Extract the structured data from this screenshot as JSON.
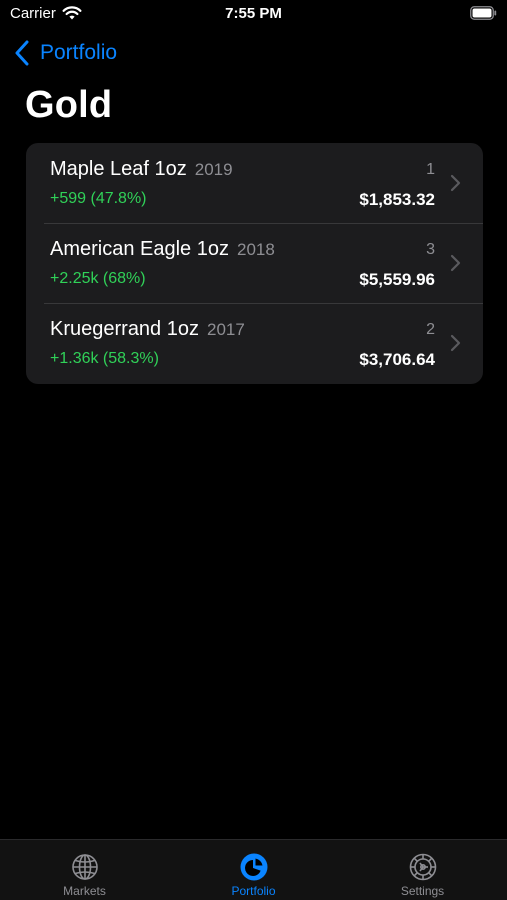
{
  "status_bar": {
    "carrier": "Carrier",
    "time": "7:55 PM"
  },
  "nav": {
    "back_label": "Portfolio"
  },
  "page": {
    "title": "Gold"
  },
  "holdings": [
    {
      "name": "Maple Leaf 1oz",
      "year": "2019",
      "change": "+599 (47.8%)",
      "quantity": "1",
      "value": "$1,853.32"
    },
    {
      "name": "American Eagle 1oz",
      "year": "2018",
      "change": "+2.25k (68%)",
      "quantity": "3",
      "value": "$5,559.96"
    },
    {
      "name": "Kruegerrand 1oz",
      "year": "2017",
      "change": "+1.36k (58.3%)",
      "quantity": "2",
      "value": "$3,706.64"
    }
  ],
  "tab_bar": {
    "tabs": [
      {
        "label": "Markets",
        "icon": "globe-icon",
        "active": false
      },
      {
        "label": "Portfolio",
        "icon": "pie-chart-icon",
        "active": true
      },
      {
        "label": "Settings",
        "icon": "gear-icon",
        "active": false
      }
    ]
  },
  "colors": {
    "accent": "#0a84ff",
    "positive": "#30d158",
    "secondary_text": "#8e8e93",
    "card_background": "#1c1c1e"
  }
}
